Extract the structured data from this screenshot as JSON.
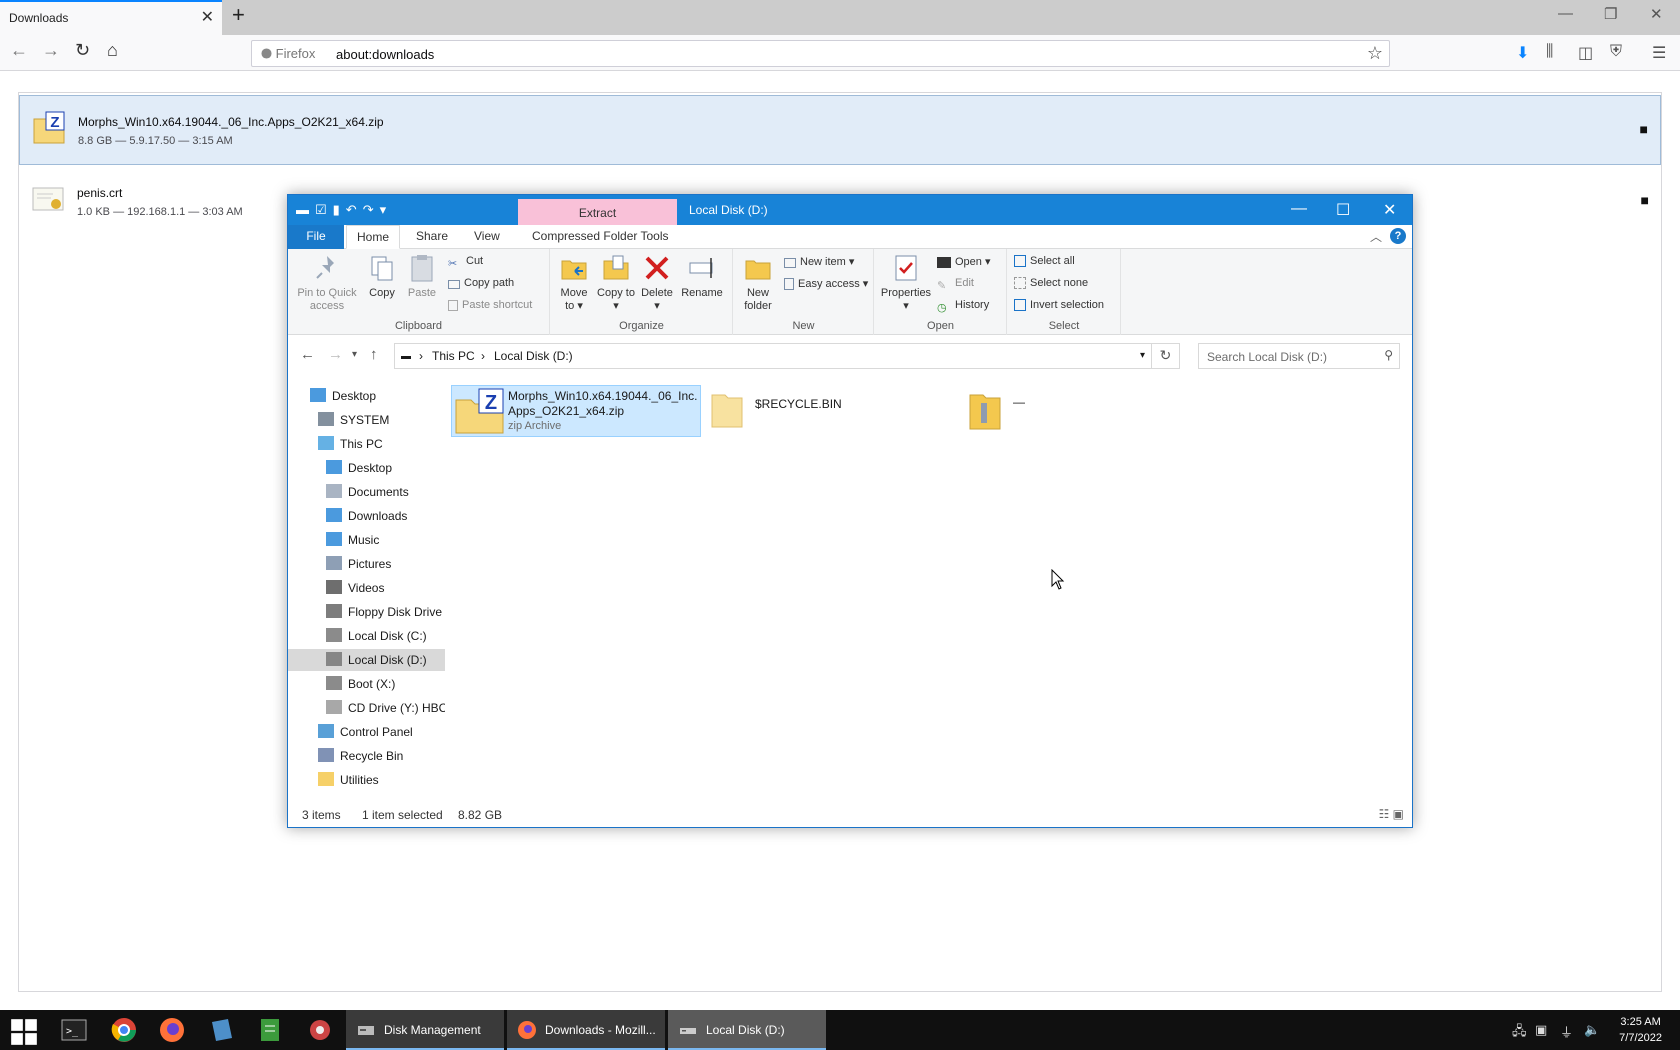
{
  "firefox": {
    "tab_title": "Downloads",
    "identity_label": "Firefox",
    "url": "about:downloads"
  },
  "downloads": [
    {
      "name": "Morphs_Win10.x64.19044._06_Inc.Apps_O2K21_x64.zip",
      "meta": "8.8 GB — 5.9.17.50 — 3:15 AM"
    },
    {
      "name": "penis.crt",
      "meta": "1.0 KB — 192.168.1.1 — 3:03 AM"
    }
  ],
  "explorer": {
    "context_tab": "Extract",
    "window_title": "Local Disk (D:)",
    "ribbon_tabs": [
      "File",
      "Home",
      "Share",
      "View",
      "Compressed Folder Tools"
    ],
    "clipboard": {
      "pin": "Pin to Quick access",
      "copy": "Copy",
      "paste": "Paste",
      "cut": "Cut",
      "copy_path": "Copy path",
      "paste_shortcut": "Paste shortcut",
      "label": "Clipboard"
    },
    "organize": {
      "move_to": "Move to",
      "copy_to": "Copy to",
      "delete": "Delete",
      "rename": "Rename",
      "label": "Organize"
    },
    "new": {
      "new_folder": "New folder",
      "new_item": "New item",
      "easy_access": "Easy access",
      "label": "New"
    },
    "open": {
      "properties": "Properties",
      "open": "Open",
      "edit": "Edit",
      "history": "History",
      "label": "Open"
    },
    "select": {
      "select_all": "Select all",
      "select_none": "Select none",
      "invert": "Invert selection",
      "label": "Select"
    },
    "breadcrumb": [
      "This PC",
      "Local Disk (D:)"
    ],
    "search_placeholder": "Search Local Disk (D:)",
    "nav_tree": [
      {
        "label": "Desktop",
        "indent": 0,
        "icon": "desktop-icon"
      },
      {
        "label": "SYSTEM",
        "indent": 1,
        "icon": "user-icon"
      },
      {
        "label": "This PC",
        "indent": 1,
        "icon": "pc-icon"
      },
      {
        "label": "Desktop",
        "indent": 2,
        "icon": "desktop-icon"
      },
      {
        "label": "Documents",
        "indent": 2,
        "icon": "documents-icon"
      },
      {
        "label": "Downloads",
        "indent": 2,
        "icon": "downloads-icon"
      },
      {
        "label": "Music",
        "indent": 2,
        "icon": "music-icon"
      },
      {
        "label": "Pictures",
        "indent": 2,
        "icon": "pictures-icon"
      },
      {
        "label": "Videos",
        "indent": 2,
        "icon": "videos-icon"
      },
      {
        "label": "Floppy Disk Drive",
        "indent": 2,
        "icon": "floppy-icon"
      },
      {
        "label": "Local Disk (C:)",
        "indent": 2,
        "icon": "drive-icon"
      },
      {
        "label": "Local Disk (D:)",
        "indent": 2,
        "icon": "drive-icon",
        "selected": true
      },
      {
        "label": "Boot (X:)",
        "indent": 2,
        "icon": "drive-icon"
      },
      {
        "label": "CD Drive (Y:) HBC",
        "indent": 2,
        "icon": "cd-icon"
      },
      {
        "label": "Control Panel",
        "indent": 1,
        "icon": "control-panel-icon"
      },
      {
        "label": "Recycle Bin",
        "indent": 1,
        "icon": "recycle-bin-icon"
      },
      {
        "label": "Utilities",
        "indent": 1,
        "icon": "folder-icon"
      }
    ],
    "files": [
      {
        "name": "Morphs_Win10.x64.19044._06_Inc.Apps_O2K21_x64.zip",
        "type": "zip Archive"
      },
      {
        "name": "$RECYCLE.BIN"
      },
      {
        "name": "—"
      }
    ],
    "status": {
      "items": "3 items",
      "selected": "1 item selected",
      "size": "8.82 GB"
    }
  },
  "taskbar": {
    "buttons": [
      "Disk Management",
      "Downloads - Mozill...",
      "Local Disk (D:)"
    ],
    "time": "3:25 AM",
    "date": "7/7/2022"
  },
  "colors": {
    "explorer_accent": "#1883d7",
    "selection": "#cce8ff",
    "context_tab": "#f9c1d8"
  }
}
